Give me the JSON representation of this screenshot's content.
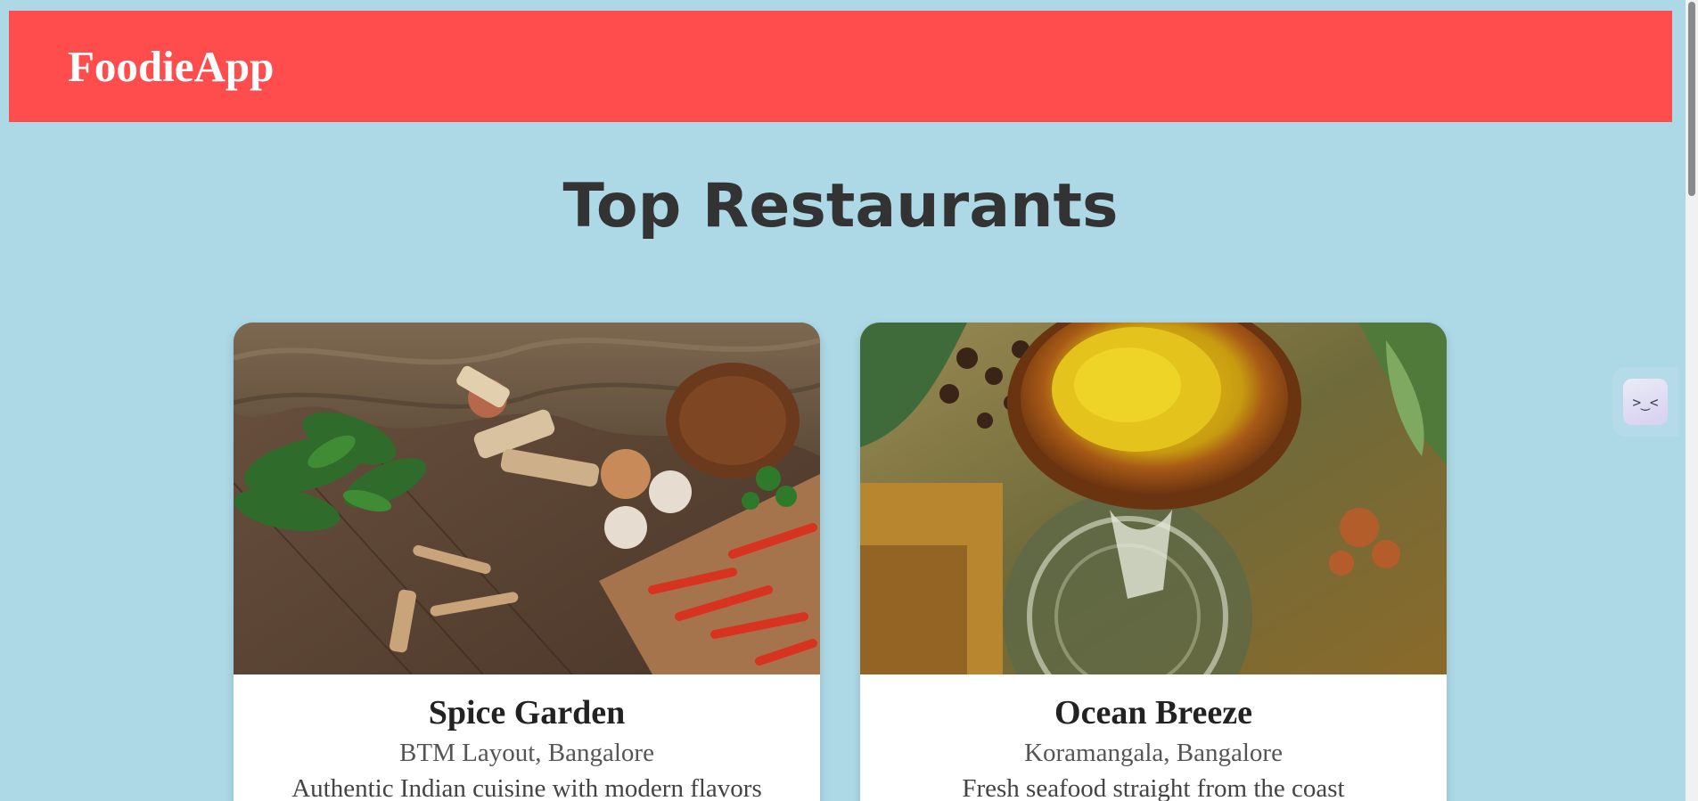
{
  "navbar": {
    "brand": "FoodieApp"
  },
  "main": {
    "title": "Top Restaurants"
  },
  "restaurants": [
    {
      "name": "Spice Garden",
      "location": "BTM Layout, Bangalore",
      "description": "Authentic Indian cuisine with modern flavors",
      "image": "spices-vegetables-photo"
    },
    {
      "name": "Ocean Breeze",
      "location": "Koramangala, Bangalore",
      "description": "Fresh seafood straight from the coast",
      "image": "turmeric-bowl-photo"
    }
  ],
  "side_widget": {
    "icon": "assistant-face-icon",
    "glyph": ">‿<"
  },
  "colors": {
    "background": "#add8e6",
    "navbar": "#ff4d4d",
    "brand_text": "#ffffff",
    "title_text": "#333333"
  }
}
